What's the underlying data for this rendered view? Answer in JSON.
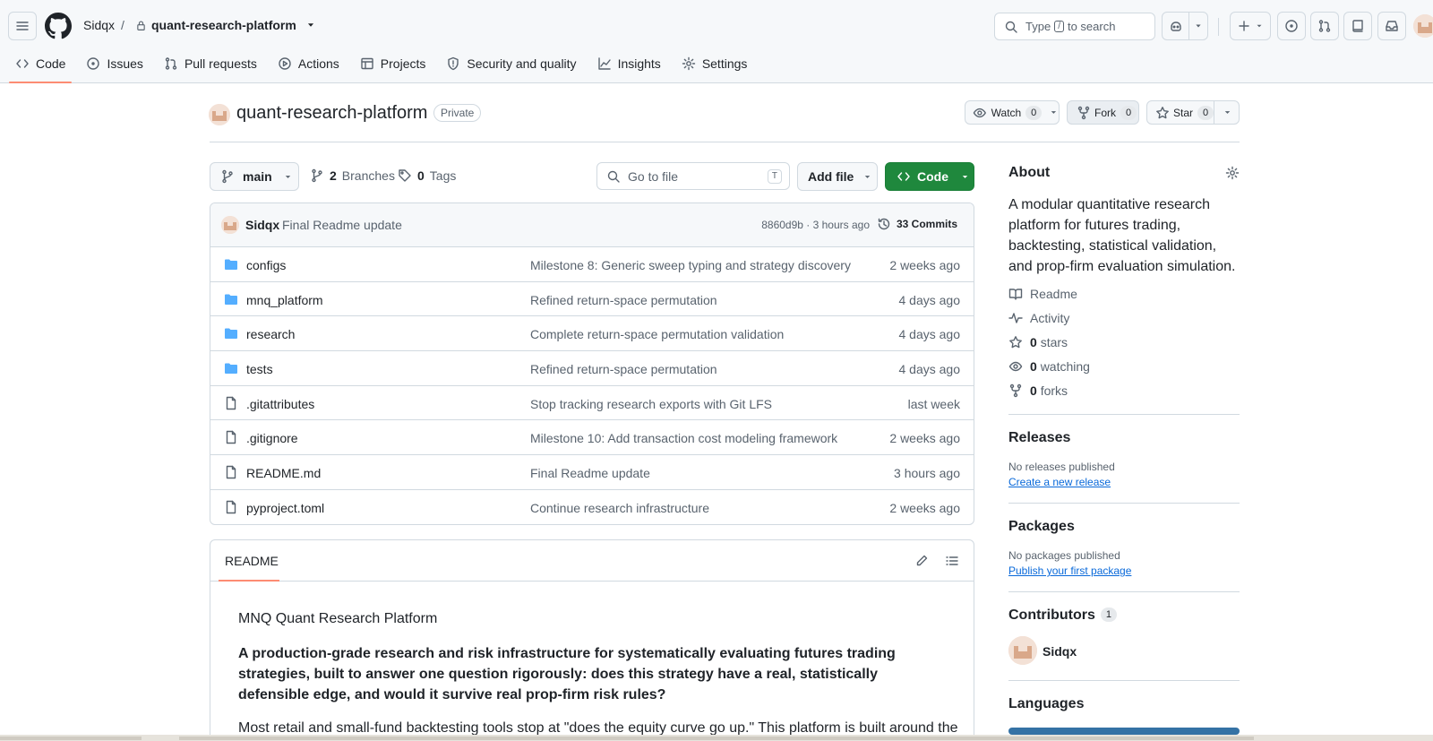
{
  "header": {
    "owner": "Sidqx",
    "separator": "/",
    "repo": "quant-research-platform",
    "search": {
      "prefix": "Type",
      "key": "/",
      "suffix": "to search"
    }
  },
  "tabs": [
    {
      "label": "Code",
      "icon": "code-icon",
      "active": true
    },
    {
      "label": "Issues",
      "icon": "issue-icon"
    },
    {
      "label": "Pull requests",
      "icon": "pull-request-icon"
    },
    {
      "label": "Actions",
      "icon": "play-icon"
    },
    {
      "label": "Projects",
      "icon": "table-icon"
    },
    {
      "label": "Security and quality",
      "icon": "shield-icon"
    },
    {
      "label": "Insights",
      "icon": "graph-icon"
    },
    {
      "label": "Settings",
      "icon": "gear-icon"
    }
  ],
  "repo": {
    "name": "quant-research-platform",
    "visibility": "Private",
    "watch": {
      "label": "Watch",
      "count": "0"
    },
    "fork": {
      "label": "Fork",
      "count": "0"
    },
    "star": {
      "label": "Star",
      "count": "0"
    }
  },
  "toolbar": {
    "branch": "main",
    "branches_count": "2",
    "branches_label": "Branches",
    "tags_count": "0",
    "tags_label": "Tags",
    "go_to_file": "Go to file",
    "go_to_file_key": "T",
    "add_file": "Add file",
    "code": "Code"
  },
  "latest_commit": {
    "author": "Sidqx",
    "message": "Final Readme update",
    "meta": "8860d9b · 3 hours ago",
    "commits": "33 Commits"
  },
  "files": [
    {
      "name": "configs",
      "type": "folder",
      "message": "Milestone 8: Generic sweep typing and strategy discovery",
      "date": "2 weeks ago"
    },
    {
      "name": "mnq_platform",
      "type": "folder",
      "message": "Refined return-space permutation",
      "date": "4 days ago"
    },
    {
      "name": "research",
      "type": "folder",
      "message": "Complete return-space permutation validation",
      "date": "4 days ago"
    },
    {
      "name": "tests",
      "type": "folder",
      "message": "Refined return-space permutation",
      "date": "4 days ago"
    },
    {
      "name": ".gitattributes",
      "type": "file",
      "message": "Stop tracking research exports with Git LFS",
      "date": "last week"
    },
    {
      "name": ".gitignore",
      "type": "file",
      "message": "Milestone 10: Add transaction cost modeling framework",
      "date": "2 weeks ago"
    },
    {
      "name": "README.md",
      "type": "file",
      "message": "Final Readme update",
      "date": "3 hours ago"
    },
    {
      "name": "pyproject.toml",
      "type": "file",
      "message": "Continue research infrastructure",
      "date": "2 weeks ago"
    }
  ],
  "readme": {
    "tab": "README",
    "heading": "MNQ Quant Research Platform",
    "lead": "A production-grade research and risk infrastructure for systematically evaluating futures trading strategies, built to answer one question rigorously: does this strategy have a real, statistically defensible edge, and would it survive real prop-firm risk rules?",
    "para": "Most retail and small-fund backtesting tools stop at \"does the equity curve go up.\" This platform is built around the"
  },
  "about": {
    "title": "About",
    "description": "A modular quantitative research platform for futures trading, backtesting, statistical validation, and prop-firm evaluation simulation.",
    "readme": "Readme",
    "activity": "Activity",
    "stars_count": "0",
    "stars_label": "stars",
    "watching_count": "0",
    "watching_label": "watching",
    "forks_count": "0",
    "forks_label": "forks"
  },
  "releases": {
    "title": "Releases",
    "empty": "No releases published",
    "link": "Create a new release"
  },
  "packages": {
    "title": "Packages",
    "empty": "No packages published",
    "link": "Publish your first package"
  },
  "contributors": {
    "title": "Contributors",
    "count": "1",
    "name": "Sidqx"
  },
  "languages": {
    "title": "Languages"
  },
  "colors": {
    "accent_green": "#1f883d",
    "tab_underline": "#fd8c73",
    "link": "#0969da",
    "folder": "#54aeff"
  }
}
